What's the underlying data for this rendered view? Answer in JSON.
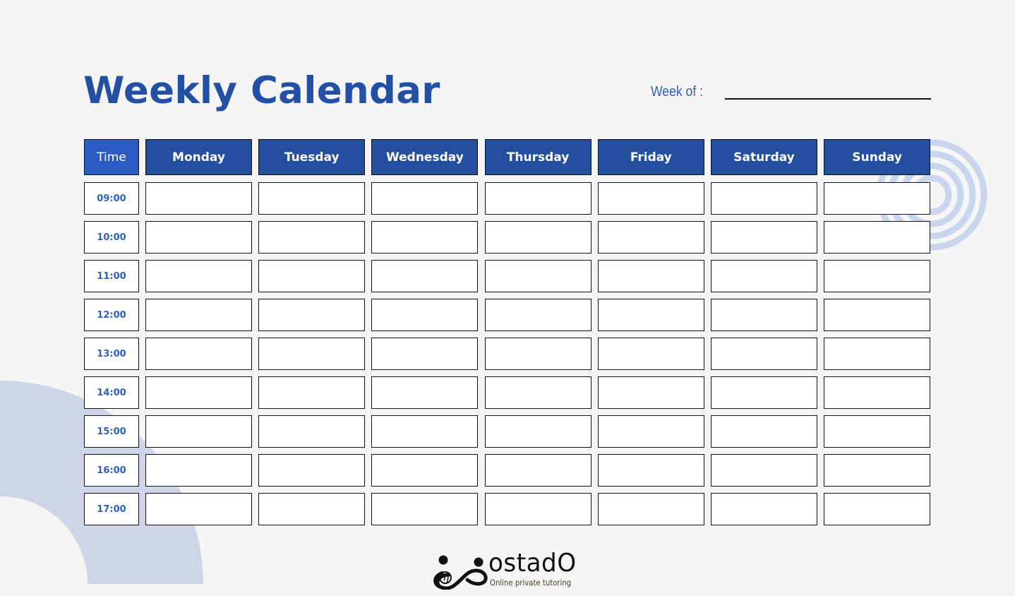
{
  "header": {
    "title": "Weekly Calendar",
    "week_of_label": "Week of :",
    "week_of_value": ""
  },
  "table": {
    "time_header": "Time",
    "days": [
      "Monday",
      "Tuesday",
      "Wednesday",
      "Thursday",
      "Friday",
      "Saturday",
      "Sunday"
    ],
    "times": [
      "09:00",
      "10:00",
      "11:00",
      "12:00",
      "13:00",
      "14:00",
      "15:00",
      "16:00",
      "17:00"
    ]
  },
  "logo": {
    "name": "ostadO",
    "tagline": "Online private tutoring",
    "icon": "infinity-people-globe-icon"
  },
  "colors": {
    "primary": "#234f9e",
    "time_header": "#2a5cc4",
    "title": "#2350a4",
    "time_text": "#2e5fc0",
    "decoration": "#cdd5e6",
    "background": "#f5f5f5"
  }
}
